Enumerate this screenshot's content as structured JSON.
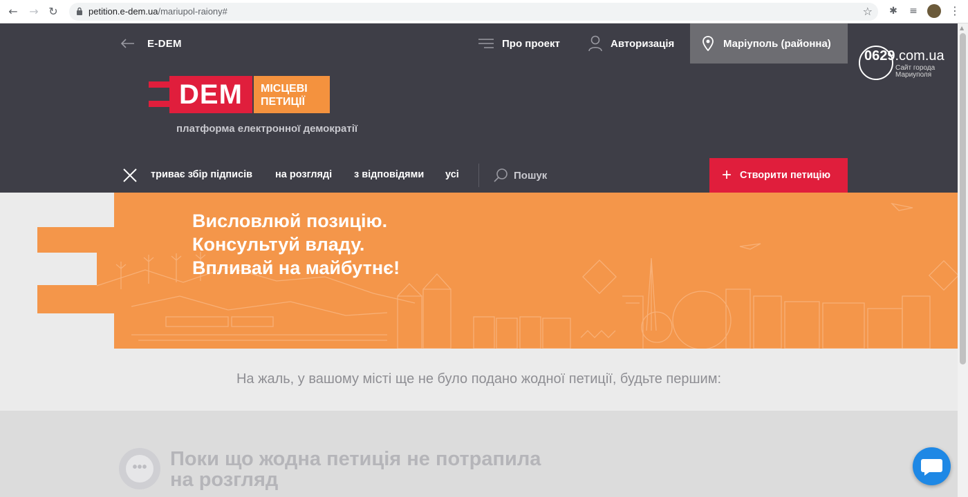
{
  "browser": {
    "url_host": "petition.e-dem.ua",
    "url_path": "/mariupol-raiony#"
  },
  "header": {
    "back_label": "E-DEM",
    "about_label": "Про проект",
    "login_label": "Авторизація",
    "city_label": "Маріуполь (районна)",
    "logo": {
      "dem": "DEM",
      "line1": "МІСЦЕВІ",
      "line2": "ПЕТИЦІЇ"
    },
    "tagline": "платформа електронної демократії"
  },
  "site_badge": {
    "number": "0629",
    "domain": ".com.ua",
    "sub1": "Сайт города",
    "sub2": "Мариуполя"
  },
  "nav": {
    "tabs": [
      {
        "label": "триває збір підписів"
      },
      {
        "label": "на розгляді"
      },
      {
        "label": "з відповідями"
      },
      {
        "label": "усі"
      }
    ],
    "search_label": "Пошук",
    "create_label": "Створити петицію"
  },
  "hero": {
    "line1": "Висловлюй позицію.",
    "line2": "Консультуй владу.",
    "line3": "Впливай на майбутнє!"
  },
  "empty_message": "На жаль, у вашому місті ще не було подано жодної петиції, будьте першим:",
  "empty_section": {
    "title_line1": "Поки що жодна петиція не потрапила",
    "title_line2": "на розгляд",
    "icon_glyph": "•••"
  },
  "colors": {
    "header_bg": "#3e3e47",
    "brand_red": "#e01e3c",
    "brand_orange": "#f4923e",
    "city_bg": "#6d6d72"
  }
}
